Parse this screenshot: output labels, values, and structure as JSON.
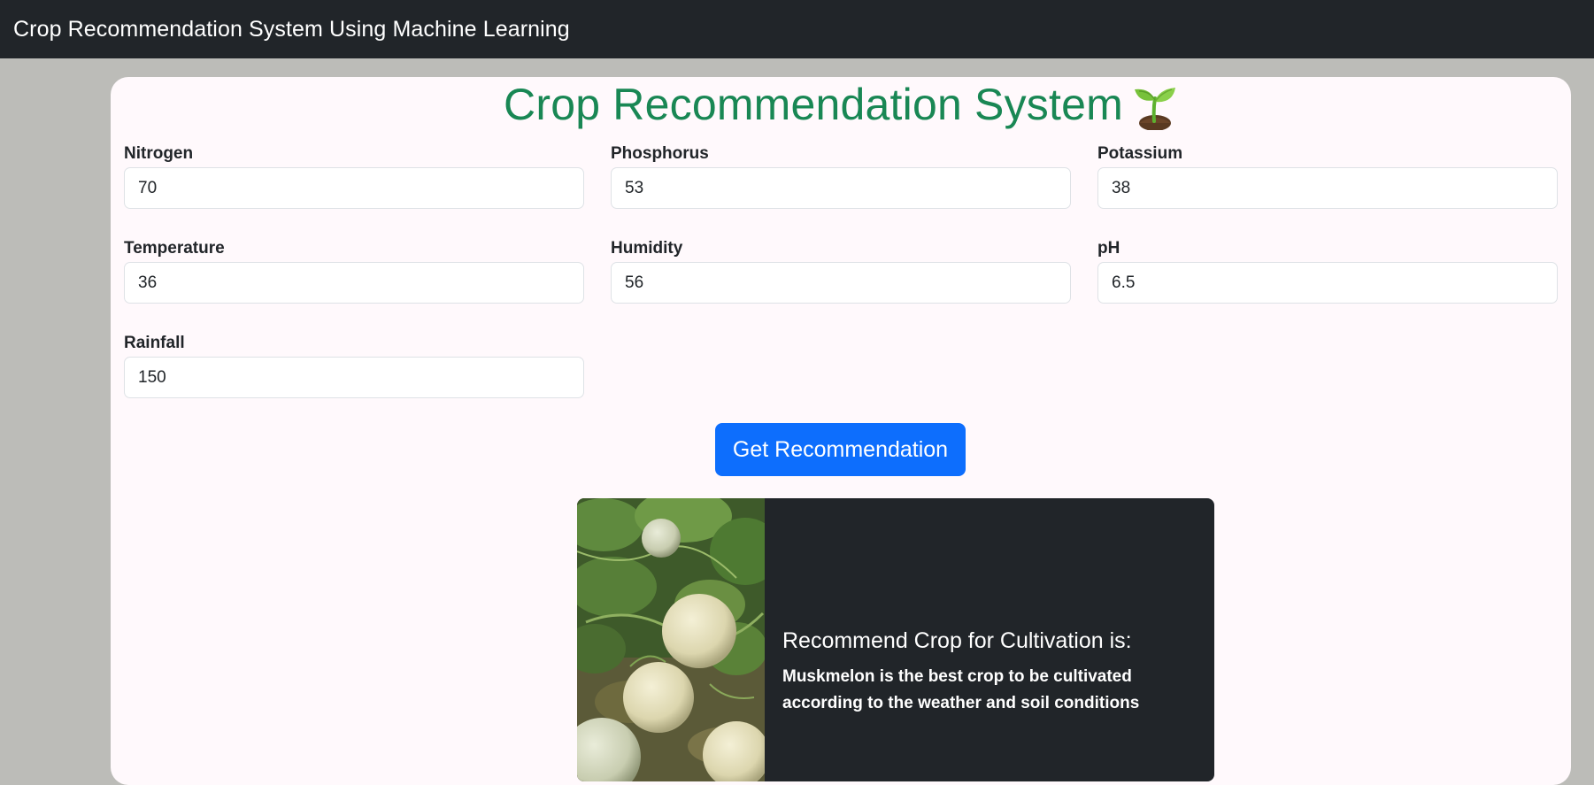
{
  "navbar": {
    "brand": "Crop Recommendation System Using Machine Learning"
  },
  "form": {
    "title": "Crop Recommendation System",
    "title_icon": "sprout-icon",
    "fields": [
      {
        "label": "Nitrogen",
        "value": "70"
      },
      {
        "label": "Phosphorus",
        "value": "53"
      },
      {
        "label": "Potassium",
        "value": "38"
      },
      {
        "label": "Temperature",
        "value": "36"
      },
      {
        "label": "Humidity",
        "value": "56"
      },
      {
        "label": "pH",
        "value": "6.5"
      },
      {
        "label": "Rainfall",
        "value": "150"
      }
    ],
    "submit_label": "Get Recommendation"
  },
  "result": {
    "image": "muskmelon-photo",
    "title": "Recommend Crop for Cultivation is:",
    "text": "Muskmelon is the best crop to be cultivated according to the weather and soil conditions"
  },
  "colors": {
    "navbar_bg": "#212529",
    "title_green": "#198754",
    "button_blue": "#0d6efd",
    "result_bg": "#212529",
    "page_bg": "#bcbcb8"
  }
}
